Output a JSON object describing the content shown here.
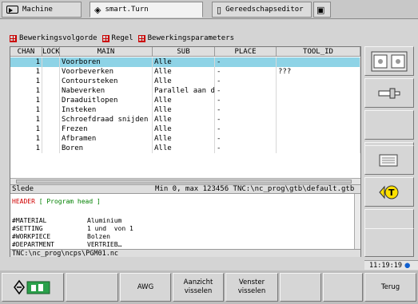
{
  "tabs": [
    {
      "label": "Machine",
      "icon": "machine-arrow-icon"
    },
    {
      "label": "smart.Turn",
      "icon": "smartturn-diamond-icon"
    },
    {
      "label": "Gereedschapseditor",
      "icon": "tool-editor-icon"
    },
    {
      "label": "",
      "icon": "save-disk-icon"
    }
  ],
  "toolbar": [
    {
      "label": "Bewerkingsvolgorde"
    },
    {
      "label": "Regel"
    },
    {
      "label": "Bewerkingsparameters"
    }
  ],
  "table": {
    "columns": [
      "CHAN",
      "LOCK",
      "MAIN",
      "SUB",
      "PLACE",
      "TOOL_ID"
    ],
    "rows": [
      {
        "chan": "1",
        "lock": "",
        "main": "Voorboren",
        "sub": "Alle",
        "place": "-",
        "tool": "",
        "selected": true
      },
      {
        "chan": "1",
        "lock": "",
        "main": "Voorbeverken",
        "sub": "Alle",
        "place": "-",
        "tool": "???"
      },
      {
        "chan": "1",
        "lock": "",
        "main": "Contoursteken",
        "sub": "Alle",
        "place": "-",
        "tool": ""
      },
      {
        "chan": "1",
        "lock": "",
        "main": "Nabeverken",
        "sub": "Parallel aan d…",
        "place": "-",
        "tool": ""
      },
      {
        "chan": "1",
        "lock": "",
        "main": "Draaduitlopen",
        "sub": "Alle",
        "place": "-",
        "tool": ""
      },
      {
        "chan": "1",
        "lock": "",
        "main": "Insteken",
        "sub": "Alle",
        "place": "-",
        "tool": ""
      },
      {
        "chan": "1",
        "lock": "",
        "main": "Schroefdraad snijden",
        "sub": "Alle",
        "place": "-",
        "tool": ""
      },
      {
        "chan": "1",
        "lock": "",
        "main": "Frezen",
        "sub": "Alle",
        "place": "-",
        "tool": ""
      },
      {
        "chan": "1",
        "lock": "",
        "main": "Afbramen",
        "sub": "Alle",
        "place": "-",
        "tool": ""
      },
      {
        "chan": "1",
        "lock": "",
        "main": "Boren",
        "sub": "Alle",
        "place": "-",
        "tool": ""
      }
    ]
  },
  "status": {
    "left": "Slede",
    "right": "Min 0, max 123456  TNC:\\nc_prog\\gtb\\default.gtb"
  },
  "editor": {
    "header_kw": "HEADER",
    "header_rest": " [ Program head ]",
    "lines": [
      {
        "key": "#MATERIAL",
        "value": "Aluminium"
      },
      {
        "key": "#SETTING",
        "value": "1 und  von 1"
      },
      {
        "key": "#WORKPIECE",
        "value": "Bolzen"
      },
      {
        "key": "#DEPARTMENT",
        "value": "VERTRIEB…"
      }
    ]
  },
  "path": "TNC:\\nc_prog\\ncps\\PGM01.nc",
  "clock": "11:19:19",
  "bottom_keys": [
    "",
    "",
    "AWG",
    "Aanzicht\nvisselen",
    "Venster\nvisselen",
    "",
    "",
    "Terug"
  ],
  "colors": {
    "selection": "#8ed3e6",
    "header_keyword": "#d00000",
    "comment": "#008000",
    "accent_red": "#cc0000"
  }
}
